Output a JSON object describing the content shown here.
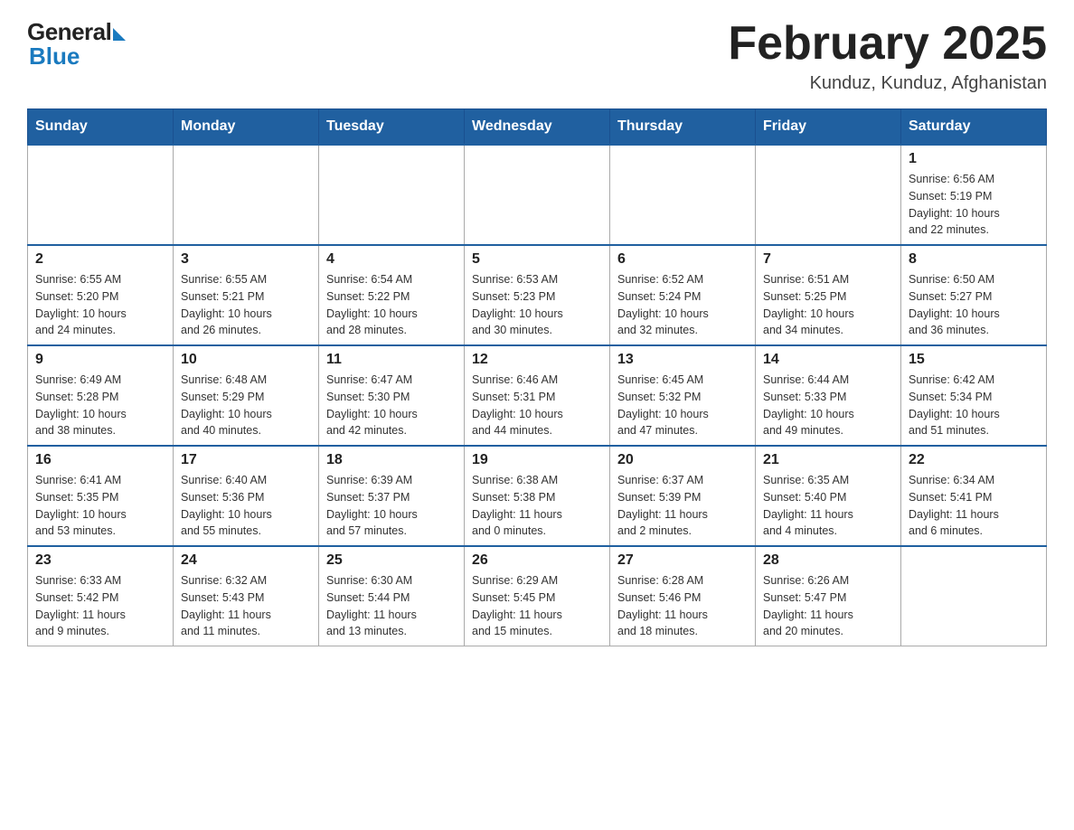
{
  "logo": {
    "general": "General",
    "blue": "Blue"
  },
  "title": "February 2025",
  "subtitle": "Kunduz, Kunduz, Afghanistan",
  "days_of_week": [
    "Sunday",
    "Monday",
    "Tuesday",
    "Wednesday",
    "Thursday",
    "Friday",
    "Saturday"
  ],
  "weeks": [
    [
      {
        "day": "",
        "info": ""
      },
      {
        "day": "",
        "info": ""
      },
      {
        "day": "",
        "info": ""
      },
      {
        "day": "",
        "info": ""
      },
      {
        "day": "",
        "info": ""
      },
      {
        "day": "",
        "info": ""
      },
      {
        "day": "1",
        "info": "Sunrise: 6:56 AM\nSunset: 5:19 PM\nDaylight: 10 hours\nand 22 minutes."
      }
    ],
    [
      {
        "day": "2",
        "info": "Sunrise: 6:55 AM\nSunset: 5:20 PM\nDaylight: 10 hours\nand 24 minutes."
      },
      {
        "day": "3",
        "info": "Sunrise: 6:55 AM\nSunset: 5:21 PM\nDaylight: 10 hours\nand 26 minutes."
      },
      {
        "day": "4",
        "info": "Sunrise: 6:54 AM\nSunset: 5:22 PM\nDaylight: 10 hours\nand 28 minutes."
      },
      {
        "day": "5",
        "info": "Sunrise: 6:53 AM\nSunset: 5:23 PM\nDaylight: 10 hours\nand 30 minutes."
      },
      {
        "day": "6",
        "info": "Sunrise: 6:52 AM\nSunset: 5:24 PM\nDaylight: 10 hours\nand 32 minutes."
      },
      {
        "day": "7",
        "info": "Sunrise: 6:51 AM\nSunset: 5:25 PM\nDaylight: 10 hours\nand 34 minutes."
      },
      {
        "day": "8",
        "info": "Sunrise: 6:50 AM\nSunset: 5:27 PM\nDaylight: 10 hours\nand 36 minutes."
      }
    ],
    [
      {
        "day": "9",
        "info": "Sunrise: 6:49 AM\nSunset: 5:28 PM\nDaylight: 10 hours\nand 38 minutes."
      },
      {
        "day": "10",
        "info": "Sunrise: 6:48 AM\nSunset: 5:29 PM\nDaylight: 10 hours\nand 40 minutes."
      },
      {
        "day": "11",
        "info": "Sunrise: 6:47 AM\nSunset: 5:30 PM\nDaylight: 10 hours\nand 42 minutes."
      },
      {
        "day": "12",
        "info": "Sunrise: 6:46 AM\nSunset: 5:31 PM\nDaylight: 10 hours\nand 44 minutes."
      },
      {
        "day": "13",
        "info": "Sunrise: 6:45 AM\nSunset: 5:32 PM\nDaylight: 10 hours\nand 47 minutes."
      },
      {
        "day": "14",
        "info": "Sunrise: 6:44 AM\nSunset: 5:33 PM\nDaylight: 10 hours\nand 49 minutes."
      },
      {
        "day": "15",
        "info": "Sunrise: 6:42 AM\nSunset: 5:34 PM\nDaylight: 10 hours\nand 51 minutes."
      }
    ],
    [
      {
        "day": "16",
        "info": "Sunrise: 6:41 AM\nSunset: 5:35 PM\nDaylight: 10 hours\nand 53 minutes."
      },
      {
        "day": "17",
        "info": "Sunrise: 6:40 AM\nSunset: 5:36 PM\nDaylight: 10 hours\nand 55 minutes."
      },
      {
        "day": "18",
        "info": "Sunrise: 6:39 AM\nSunset: 5:37 PM\nDaylight: 10 hours\nand 57 minutes."
      },
      {
        "day": "19",
        "info": "Sunrise: 6:38 AM\nSunset: 5:38 PM\nDaylight: 11 hours\nand 0 minutes."
      },
      {
        "day": "20",
        "info": "Sunrise: 6:37 AM\nSunset: 5:39 PM\nDaylight: 11 hours\nand 2 minutes."
      },
      {
        "day": "21",
        "info": "Sunrise: 6:35 AM\nSunset: 5:40 PM\nDaylight: 11 hours\nand 4 minutes."
      },
      {
        "day": "22",
        "info": "Sunrise: 6:34 AM\nSunset: 5:41 PM\nDaylight: 11 hours\nand 6 minutes."
      }
    ],
    [
      {
        "day": "23",
        "info": "Sunrise: 6:33 AM\nSunset: 5:42 PM\nDaylight: 11 hours\nand 9 minutes."
      },
      {
        "day": "24",
        "info": "Sunrise: 6:32 AM\nSunset: 5:43 PM\nDaylight: 11 hours\nand 11 minutes."
      },
      {
        "day": "25",
        "info": "Sunrise: 6:30 AM\nSunset: 5:44 PM\nDaylight: 11 hours\nand 13 minutes."
      },
      {
        "day": "26",
        "info": "Sunrise: 6:29 AM\nSunset: 5:45 PM\nDaylight: 11 hours\nand 15 minutes."
      },
      {
        "day": "27",
        "info": "Sunrise: 6:28 AM\nSunset: 5:46 PM\nDaylight: 11 hours\nand 18 minutes."
      },
      {
        "day": "28",
        "info": "Sunrise: 6:26 AM\nSunset: 5:47 PM\nDaylight: 11 hours\nand 20 minutes."
      },
      {
        "day": "",
        "info": ""
      }
    ]
  ]
}
